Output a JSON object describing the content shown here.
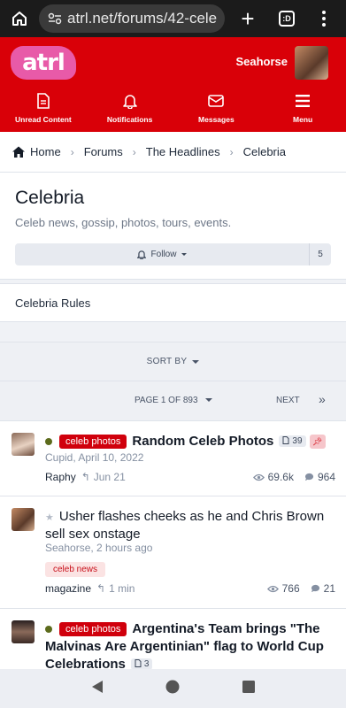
{
  "browser": {
    "url": "atrl.net/forums/42-cele",
    "tab_count": ":D"
  },
  "site": {
    "logo_text": "atrl",
    "username": "Seahorse",
    "nav": [
      {
        "label": "Unread Content",
        "icon": "document-icon"
      },
      {
        "label": "Notifications",
        "icon": "bell-icon"
      },
      {
        "label": "Messages",
        "icon": "envelope-icon"
      },
      {
        "label": "Menu",
        "icon": "hamburger-icon"
      }
    ]
  },
  "breadcrumb": [
    "Home",
    "Forums",
    "The Headlines",
    "Celebria"
  ],
  "forum": {
    "title": "Celebria",
    "description": "Celeb news, gossip, photos, tours, events.",
    "follow_label": "Follow",
    "follow_count": "5",
    "rules_label": "Celebria Rules"
  },
  "controls": {
    "sort_label": "SORT BY",
    "page_label": "PAGE 1 OF 893",
    "next_label": "NEXT",
    "last_label": "»"
  },
  "threads": [
    {
      "prefix": "celeb photos",
      "title": "Random Celeb Photos",
      "pages": "39",
      "starter": "Cupid, April 10, 2022",
      "last_poster": "Raphy",
      "last_time": "Jun 21",
      "views": "69.6k",
      "replies": "964"
    },
    {
      "prefix": "celeb news",
      "title": "Usher flashes cheeks as he and Chris Brown sell sex onstage",
      "starter": "Seahorse, 2 hours ago",
      "last_poster": "magazine",
      "last_time": "1 min",
      "views": "766",
      "replies": "21"
    },
    {
      "prefix": "celeb photos",
      "title": "Argentina's Team brings \"The Malvinas Are Argentinian\" flag to World Cup Celebrations",
      "pages": "3"
    }
  ],
  "colors": {
    "brand_red": "#d90008",
    "prefix_red": "#d0000c",
    "logo_pink": "#e85aa8"
  }
}
